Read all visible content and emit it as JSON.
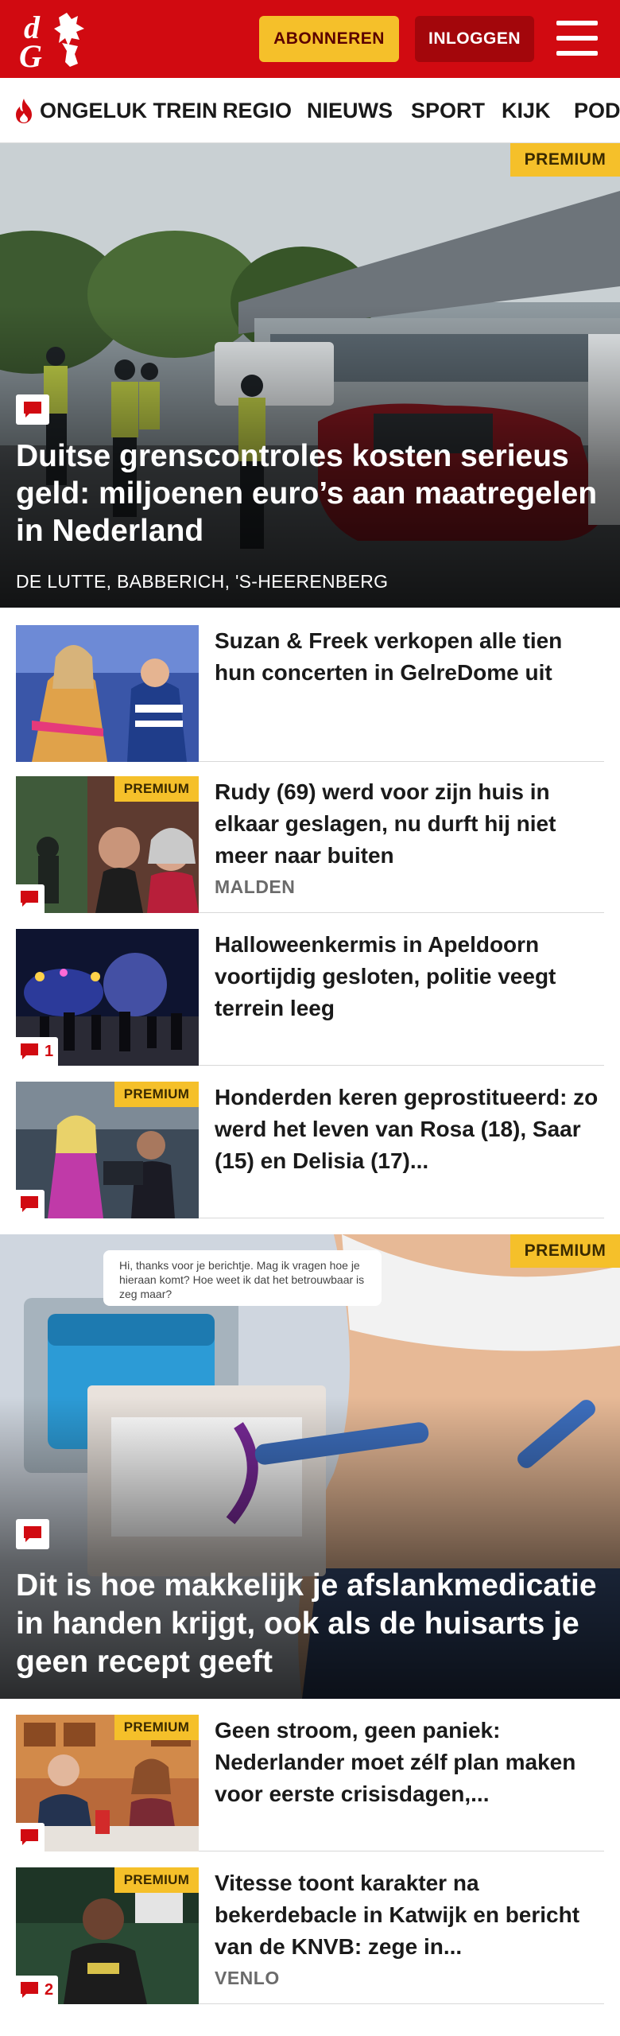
{
  "header": {
    "logo_text": "dG",
    "subscribe_label": "ABONNEREN",
    "login_label": "INLOGGEN"
  },
  "nav": {
    "items": [
      "ONGELUK TREIN",
      "REGIO",
      "NIEUWS",
      "SPORT",
      "KIJK",
      "POD"
    ]
  },
  "hero1": {
    "premium": "PREMIUM",
    "title": "Duitse grenscontroles kosten serieus geld: miljoenen euro’s aan maatregelen in Nederland",
    "location": "DE LUTTE, BABBERICH, 'S-HEERENBERG"
  },
  "articles": [
    {
      "title": "Suzan & Freek verkopen alle tien hun concerten in GelreDome uit",
      "premium": "",
      "comments": "",
      "location": ""
    },
    {
      "title": "Rudy (69) werd voor zijn huis in elkaar geslagen, nu durft hij niet meer naar buiten",
      "premium": "PREMIUM",
      "comments": "",
      "location": "MALDEN"
    },
    {
      "title": "Halloweenkermis in Apeldoorn voortijdig gesloten, politie veegt terrein leeg",
      "premium": "",
      "comments": "1",
      "location": ""
    },
    {
      "title": "Honderden keren geprostitueerd: zo werd het leven van Rosa (18), Saar (15) en Delisia (17)...",
      "premium": "PREMIUM",
      "comments": "",
      "location": ""
    }
  ],
  "hero2": {
    "premium": "PREMIUM",
    "title": "Dit is hoe makkelijk je afslankmedicatie in handen krijgt, ook als de huisarts je geen recept geeft",
    "chat_text": "Hi, thanks voor je berichtje. Mag ik vragen hoe je hieraan komt? Hoe weet ik dat het betrouwbaar is zeg maar?"
  },
  "articles2": [
    {
      "title": "Geen stroom, geen paniek: Nederlander moet zélf plan maken voor eerste crisisdagen,...",
      "premium": "PREMIUM",
      "comments": "",
      "location": ""
    },
    {
      "title": "Vitesse toont karakter na bekerdebacle in Katwijk en bericht van de KNVB: zege in...",
      "premium": "PREMIUM",
      "comments": "2",
      "location": "VENLO"
    }
  ],
  "colors": {
    "brand_red": "#d10a11",
    "dark_red": "#a3060b",
    "premium_yellow": "#f5c02a"
  }
}
